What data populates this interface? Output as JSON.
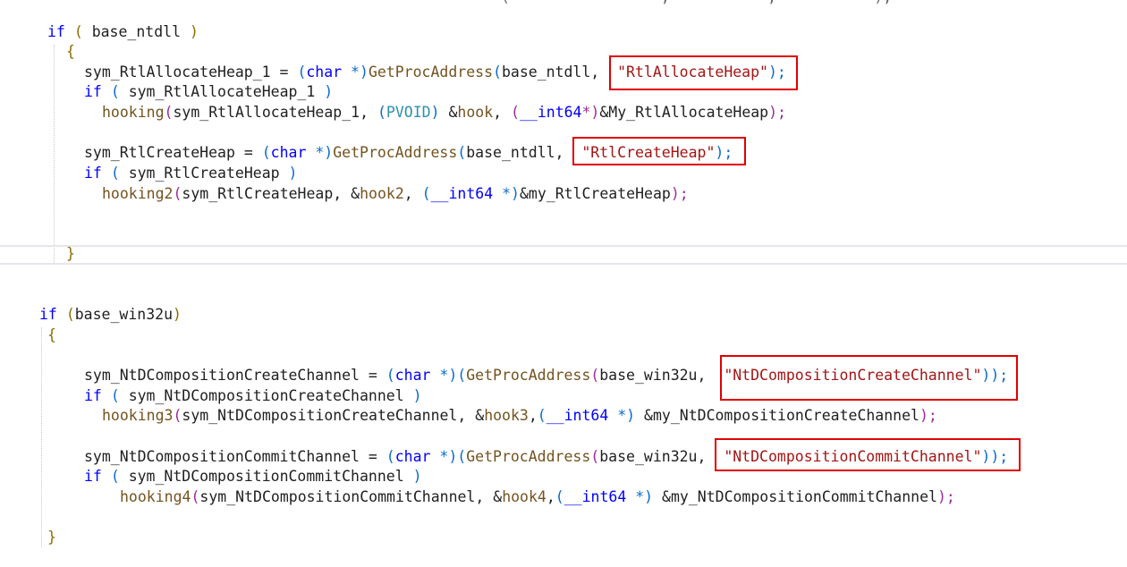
{
  "top_fragment": "(                 ,           ,           );",
  "block1": {
    "if_line": {
      "kw": "if",
      "open": "(",
      "cond": "base_ntdll",
      "close": ")"
    },
    "open_brace": "{",
    "alloc_assign": {
      "var": "sym_RtlAllocateHeap_1",
      "eq": " = ",
      "cast_open": "(",
      "cast_type": "char",
      "cast_rest": " *)",
      "func": "GetProcAddress",
      "args_open": "(",
      "arg1": "base_ntdll,",
      "str": "\"RtlAllocateHeap\"",
      "args_close": ");"
    },
    "alloc_if": {
      "kw": "if",
      "open": "(",
      "cond": "sym_RtlAllocateHeap_1",
      "close": ")"
    },
    "alloc_hook": {
      "func": "hooking",
      "open": "(",
      "arg1": "sym_RtlAllocateHeap_1, ",
      "cast1_open": "(",
      "cast1_type": "PVOID",
      "cast1_close": ")",
      "arg2_amp": " &",
      "arg2": "hook",
      "comma": ", ",
      "cast2_open": "(",
      "cast2_type": "__int64",
      "cast2_rest": "*)",
      "arg3": "&My_RtlAllocateHeap",
      "close": ");"
    },
    "create_assign": {
      "var": "sym_RtlCreateHeap",
      "eq": " = ",
      "cast_open": "(",
      "cast_type": "char",
      "cast_rest": " *)",
      "func": "GetProcAddress",
      "args_open": "(",
      "arg1": "base_ntdll,",
      "str": "\"RtlCreateHeap\"",
      "args_close": ");"
    },
    "create_if": {
      "kw": "if",
      "open": "(",
      "cond": "sym_RtlCreateHeap",
      "close": ")"
    },
    "create_hook": {
      "func": "hooking2",
      "open": "(",
      "arg1": "sym_RtlCreateHeap, &",
      "arg2": "hook2",
      "comma": ", ",
      "cast_open": "(",
      "cast_type": "__int64",
      "cast_rest": " *)",
      "arg3": "&my_RtlCreateHeap",
      "close": ");"
    },
    "close_brace": "}"
  },
  "block2": {
    "if_line": {
      "kw": "if",
      "open": "(",
      "cond": "base_win32u",
      "close": ")"
    },
    "open_brace": "{",
    "create_assign": {
      "var": "sym_NtDCompositionCreateChannel",
      "eq": " = ",
      "cast_open": "(",
      "cast_type": "char",
      "cast_rest": " *)",
      "paren_open": "(",
      "func": "GetProcAddress",
      "args_open": "(",
      "arg1": "base_win32u,",
      "str": "\"NtDCompositionCreateChannel\"",
      "args_close": "));"
    },
    "create_if": {
      "kw": "if",
      "open": "(",
      "cond": "sym_NtDCompositionCreateChannel",
      "close": ")"
    },
    "create_hook": {
      "func": "hooking3",
      "open": "(",
      "arg1": "sym_NtDCompositionCreateChannel, &",
      "arg2": "hook3",
      "comma": ",",
      "cast_open": "(",
      "cast_type": "__int64",
      "cast_rest": " *)",
      "arg3": " &my_NtDCompositionCreateChannel",
      "close": ");"
    },
    "commit_assign": {
      "var": "sym_NtDCompositionCommitChannel",
      "eq": " = ",
      "cast_open": "(",
      "cast_type": "char",
      "cast_rest": " *)",
      "paren_open": "(",
      "func": "GetProcAddress",
      "args_open": "(",
      "arg1": "base_win32u,",
      "str": "\"NtDCompositionCommitChannel\"",
      "args_close": "));"
    },
    "commit_if": {
      "kw": "if",
      "open": "(",
      "cond": "sym_NtDCompositionCommitChannel",
      "close": ")"
    },
    "commit_hook": {
      "func": "hooking4",
      "open": "(",
      "arg1": "sym_NtDCompositionCommitChannel, &",
      "arg2": "hook4",
      "comma": ",",
      "cast_open": "(",
      "cast_type": "__int64",
      "cast_rest": " *)",
      "arg3": " &my_NtDCompositionCommitChannel",
      "close": ");"
    },
    "close_brace": "}"
  },
  "colors": {
    "keyword": "#0000ff",
    "function": "#74531f",
    "string": "#a31515",
    "type": "#2b91af",
    "highlight_box": "#e00000"
  }
}
